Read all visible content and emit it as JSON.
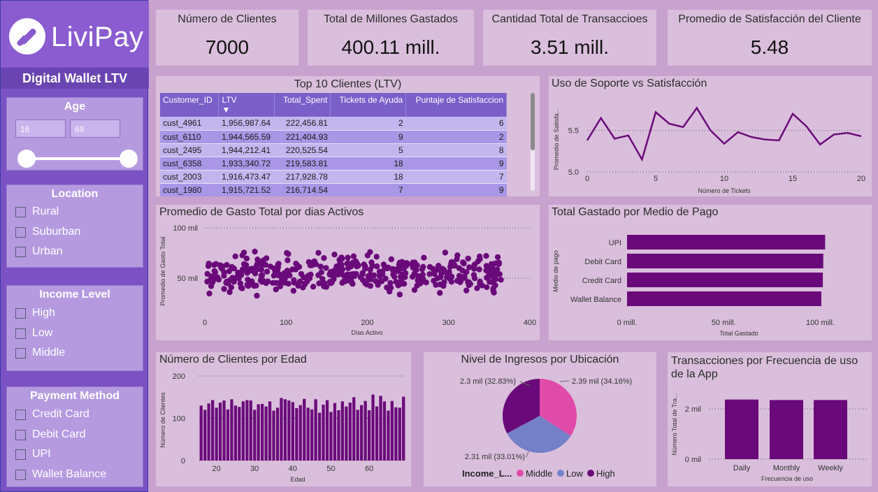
{
  "brand": {
    "logo_text": "LiviPay",
    "subtitle": "Digital Wallet LTV"
  },
  "filters": {
    "age": {
      "title": "Age",
      "min_value": "16",
      "max_value": "69"
    },
    "location": {
      "title": "Location",
      "options": [
        "Rural",
        "Suburban",
        "Urban"
      ]
    },
    "income": {
      "title": "Income Level",
      "options": [
        "High",
        "Low",
        "Middle"
      ]
    },
    "payment": {
      "title": "Payment Method",
      "options": [
        "Credit Card",
        "Debit Card",
        "UPI",
        "Wallet Balance"
      ]
    }
  },
  "kpis": [
    {
      "label": "Número de Clientes",
      "value": "7000"
    },
    {
      "label": "Total de Millones Gastados",
      "value": "400.11 mill."
    },
    {
      "label": "Cantidad Total de Transaccioes",
      "value": "3.51 mill."
    },
    {
      "label": "Promedio de Satisfacción del Cliente",
      "value": "5.48"
    }
  ],
  "top_clients": {
    "title": "Top 10 Clientes (LTV)",
    "columns": [
      "Customer_ID",
      "LTV",
      "Total_Spent",
      "Tickets de Ayuda",
      "Puntaje de Satisfaccion"
    ],
    "sort_indicator": "▼",
    "rows": [
      [
        "cust_4961",
        "1,956,987.64",
        "222,456.81",
        "2",
        "6"
      ],
      [
        "cust_6110",
        "1,944,565.59",
        "221,404.93",
        "9",
        "2"
      ],
      [
        "cust_2495",
        "1,944,212.41",
        "220,525.54",
        "5",
        "8"
      ],
      [
        "cust_6358",
        "1,933,340.72",
        "219,583.81",
        "18",
        "9"
      ],
      [
        "cust_2003",
        "1,916,473.47",
        "217,928.78",
        "18",
        "7"
      ],
      [
        "cust_1980",
        "1,915,721.52",
        "216,714.54",
        "7",
        "9"
      ]
    ]
  },
  "colors": {
    "purple": "#6a0a7a",
    "pink": "#e04aa8",
    "blue": "#7480c8",
    "sidebar": "#7b52c4"
  },
  "chart_data": [
    {
      "id": "support",
      "type": "line",
      "title": "Uso de Soporte vs Satisfacción",
      "xlabel": "Número de Tickets",
      "ylabel": "Promedio de Satisfa...",
      "xlim": [
        0,
        20
      ],
      "ylim": [
        5.0,
        5.8
      ],
      "xticks": [
        "0",
        "5",
        "10",
        "15",
        "20"
      ],
      "yticks": [
        "5.0",
        "5.5"
      ],
      "x": [
        0,
        1,
        2,
        3,
        4,
        5,
        6,
        7,
        8,
        9,
        10,
        11,
        12,
        13,
        14,
        15,
        16,
        17,
        18,
        19,
        20
      ],
      "y": [
        5.38,
        5.65,
        5.4,
        5.44,
        5.15,
        5.72,
        5.58,
        5.54,
        5.77,
        5.5,
        5.34,
        5.48,
        5.42,
        5.39,
        5.38,
        5.7,
        5.55,
        5.33,
        5.45,
        5.47,
        5.43
      ]
    },
    {
      "id": "scatter",
      "type": "scatter",
      "title": "Promedio de Gasto Total por dias Activos",
      "xlabel": "Días Activo",
      "ylabel": "Promedio de Gasto Total",
      "xlim": [
        0,
        400
      ],
      "ylim": [
        20,
        100
      ],
      "xticks": [
        "0",
        "100",
        "200",
        "300",
        "400"
      ],
      "yticks": [
        "50 mil",
        "100 mil"
      ]
    },
    {
      "id": "payment",
      "type": "bar",
      "title": "Total Gastado por Medio de Pago",
      "xlabel": "Total Gastado",
      "ylabel": "Medio de pago",
      "categories": [
        "UPI",
        "Debit Card",
        "Credit Card",
        "Wallet Balance"
      ],
      "values": [
        102.5,
        101.5,
        101.3,
        100.5
      ],
      "xlim": [
        0,
        115
      ],
      "xticks": [
        "0 mill.",
        "50 mill.",
        "100 mill."
      ]
    },
    {
      "id": "age",
      "type": "bar",
      "title": "Número de Clientes por Edad",
      "xlabel": "Edad",
      "ylabel": "Número de Clientes",
      "ylim": [
        0,
        200
      ],
      "xticks": [
        "20",
        "30",
        "40",
        "50",
        "60"
      ],
      "yticks": [
        "0",
        "100",
        "200"
      ],
      "x": [
        16,
        17,
        18,
        19,
        20,
        21,
        22,
        23,
        24,
        25,
        26,
        27,
        28,
        29,
        30,
        31,
        32,
        33,
        34,
        35,
        36,
        37,
        38,
        39,
        40,
        41,
        42,
        43,
        44,
        45,
        46,
        47,
        48,
        49,
        50,
        51,
        52,
        53,
        54,
        55,
        56,
        57,
        58,
        59,
        60,
        61,
        62,
        63,
        64,
        65,
        66,
        67,
        68,
        69
      ],
      "values": [
        130,
        120,
        135,
        143,
        125,
        137,
        142,
        121,
        145,
        130,
        127,
        140,
        143,
        142,
        120,
        133,
        134,
        128,
        140,
        118,
        125,
        148,
        145,
        142,
        138,
        124,
        131,
        146,
        125,
        121,
        145,
        113,
        132,
        143,
        115,
        136,
        119,
        140,
        128,
        137,
        150,
        120,
        131,
        141,
        119,
        156,
        128,
        153,
        140,
        118,
        141,
        126,
        125,
        151
      ]
    },
    {
      "id": "income",
      "type": "pie",
      "title": "Nivel de Ingresos por Ubicación",
      "legend_title": "Income_L...",
      "categories": [
        "Middle",
        "Low",
        "High"
      ],
      "values": [
        2.39,
        2.31,
        2.3
      ],
      "labels": [
        "2.39 mil (34.16%)",
        "2.31 mil (33.01%)",
        "2.3 mil (32.83%)"
      ]
    },
    {
      "id": "freq",
      "type": "bar",
      "title": "Transacciones por Frecuencia de uso de la App",
      "xlabel": "Frecuencia de uso",
      "ylabel": "Número Total de Tra...",
      "categories": [
        "Daily",
        "Monthly",
        "Weekly"
      ],
      "values": [
        2.37,
        2.35,
        2.35
      ],
      "ylim": [
        0,
        3
      ],
      "yticks": [
        "0 mil",
        "2 mil"
      ]
    }
  ]
}
